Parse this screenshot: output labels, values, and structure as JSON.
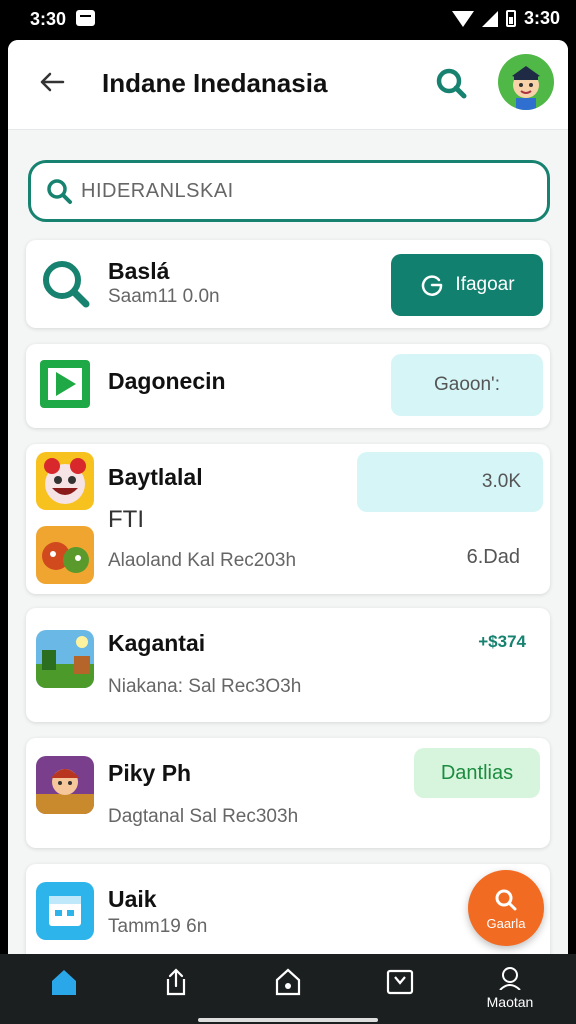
{
  "status_bar": {
    "time_left": "3:30",
    "time_right": "3:30"
  },
  "header": {
    "title": "Indane Inedanasia"
  },
  "search": {
    "value": "HIDERANLSKAI",
    "placeholder": "HIDERANLSKAI"
  },
  "cards": [
    {
      "title": "Baslá",
      "subtitle": "Saam11 0.0n",
      "action": "Ifagoar"
    },
    {
      "title": "Dagonecin",
      "action": "Gaoon':"
    },
    {
      "title": "Baytlalal",
      "subtitle": "FTI",
      "subtitle2": "Alaoland Kal Rec203h",
      "action": "3.0K",
      "value": "6.Dad"
    },
    {
      "title": "Kagantai",
      "subtitle": "Niakana: Sal Rec3O3h",
      "value": "+$374"
    },
    {
      "title": "Piky Ph",
      "subtitle": "Dagtanal Sal Rec303h",
      "action": "Dantlias"
    },
    {
      "title": "Uaik",
      "subtitle": "Tamm19 6n"
    }
  ],
  "fab": {
    "label": "Gaarla"
  },
  "bottom_nav": {
    "profile_label": "Maotan"
  },
  "colors": {
    "primary": "#11806f",
    "fab": "#f26b22",
    "light_button": "#d6f5f7",
    "green_button": "#d6f5dc"
  }
}
